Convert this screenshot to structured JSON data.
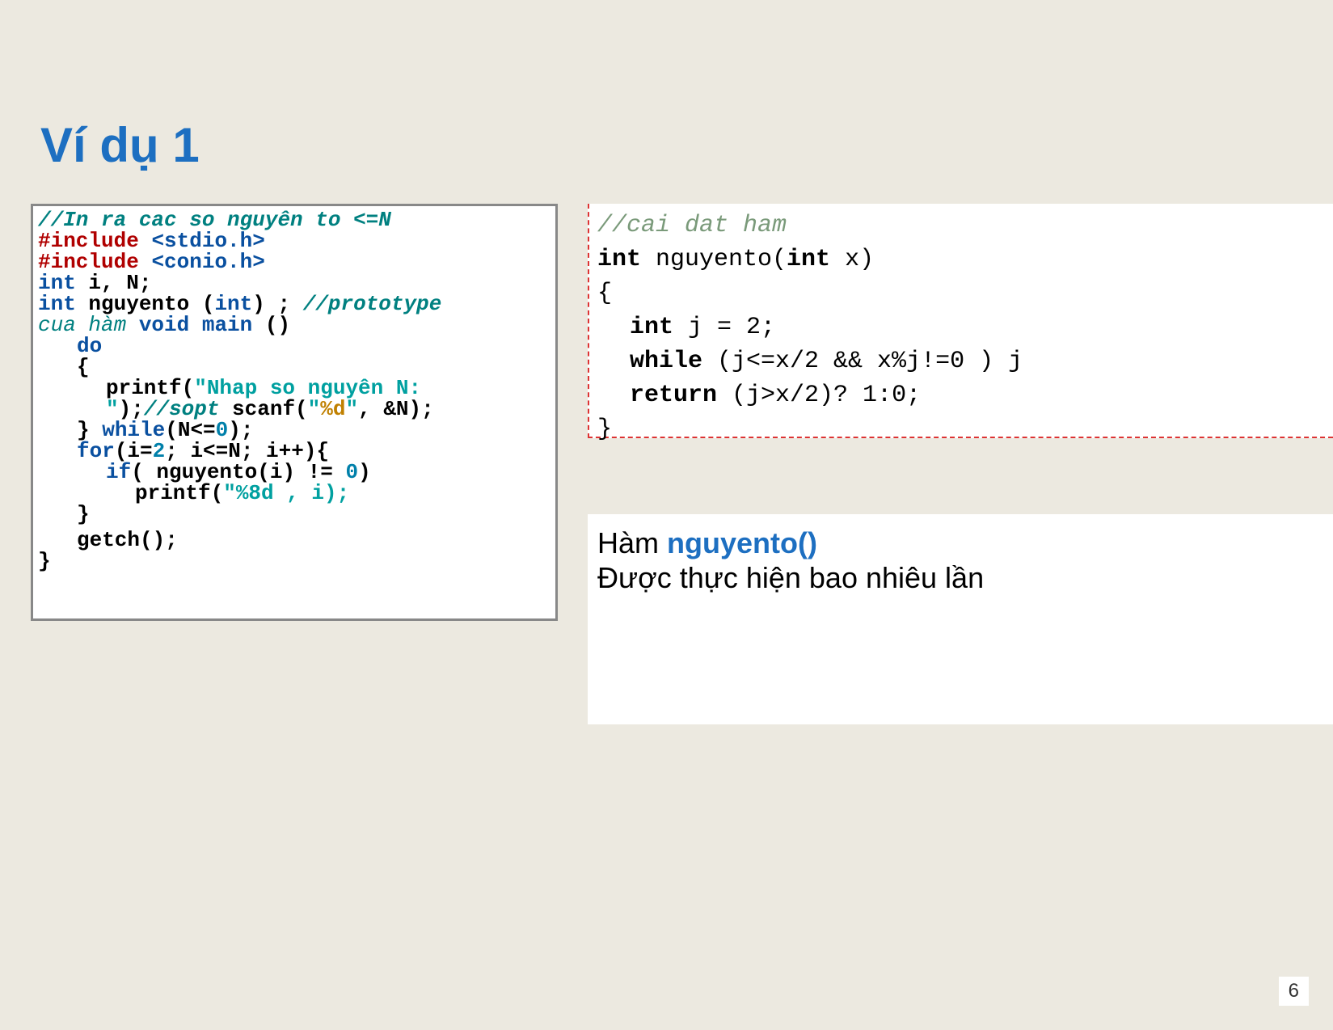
{
  "title": "Ví dụ 1",
  "page_number": "6",
  "left": {
    "l1": "//In ra cac so nguyên to <=N",
    "l2a": "#include",
    "l2b": "<stdio.h>",
    "l3a": "#include",
    "l3b": "<conio.h>",
    "l4a": "int",
    "l4b": " i, N;",
    "l5a": "int",
    "l5b": " nguyento (",
    "l5c": "int",
    "l5d": ") ; ",
    "l5e": "//prototype",
    "l6a": "cua hàm ",
    "l6b": "void main",
    "l6c": " ()",
    "l7": "do",
    "l8": "{",
    "l9a": "printf(",
    "l9b": "\"Nhap so nguyên N:",
    "l10a": "\"",
    "l10b": ");",
    "l10c": "//sopt ",
    "l10d": "scanf(",
    "l10e": "\"",
    "l10f": "%d",
    "l10g": "\"",
    "l10h": ", &N);",
    "l11a": "} ",
    "l11b": "while",
    "l11c": "(N<=",
    "l11d": "0",
    "l11e": ");",
    "l12a": "for",
    "l12b": "(i=",
    "l12c": "2",
    "l12d": "; i<=N; i++){",
    "l13a": "if",
    "l13b": "( nguyento(i) != ",
    "l13c": "0",
    "l13d": ")",
    "l14a": "printf(",
    "l14b": "\"%8d , i);",
    "l15": "}",
    "l16": "getch();",
    "l17": "}"
  },
  "right": {
    "r1": "//cai dat ham",
    "r2a": "int",
    "r2b": " nguyento(",
    "r2c": "int",
    "r2d": " x)",
    "r3": "{",
    "r4a": "int",
    "r4b": " j = 2;",
    "r5a": "while",
    "r5b": " (j<=x/2 && x%j!=0 )  j",
    "r6a": "return",
    "r6b": " (j>x/2)? 1:0;",
    "r7": "}"
  },
  "caption": {
    "c1a": "Hàm ",
    "c1b": "nguyento()",
    "c2": "Được thực hiện bao nhiêu lần"
  }
}
